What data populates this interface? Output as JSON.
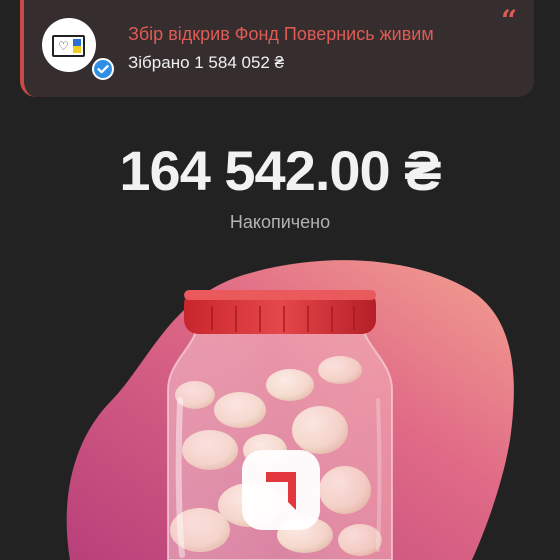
{
  "notice": {
    "title": "Збір відкрив Фонд Повернись живим",
    "collected": "Зібрано 1 584 052 ₴",
    "quote_mark": "“",
    "accent": "#df5b55"
  },
  "jar": {
    "amount": "164 542.00 ₴",
    "label": "Накопичено"
  },
  "icons": [
    "fund-logo-icon",
    "verified-badge-icon",
    "quote-icon",
    "jar-icon",
    "brand-logo-icon"
  ]
}
